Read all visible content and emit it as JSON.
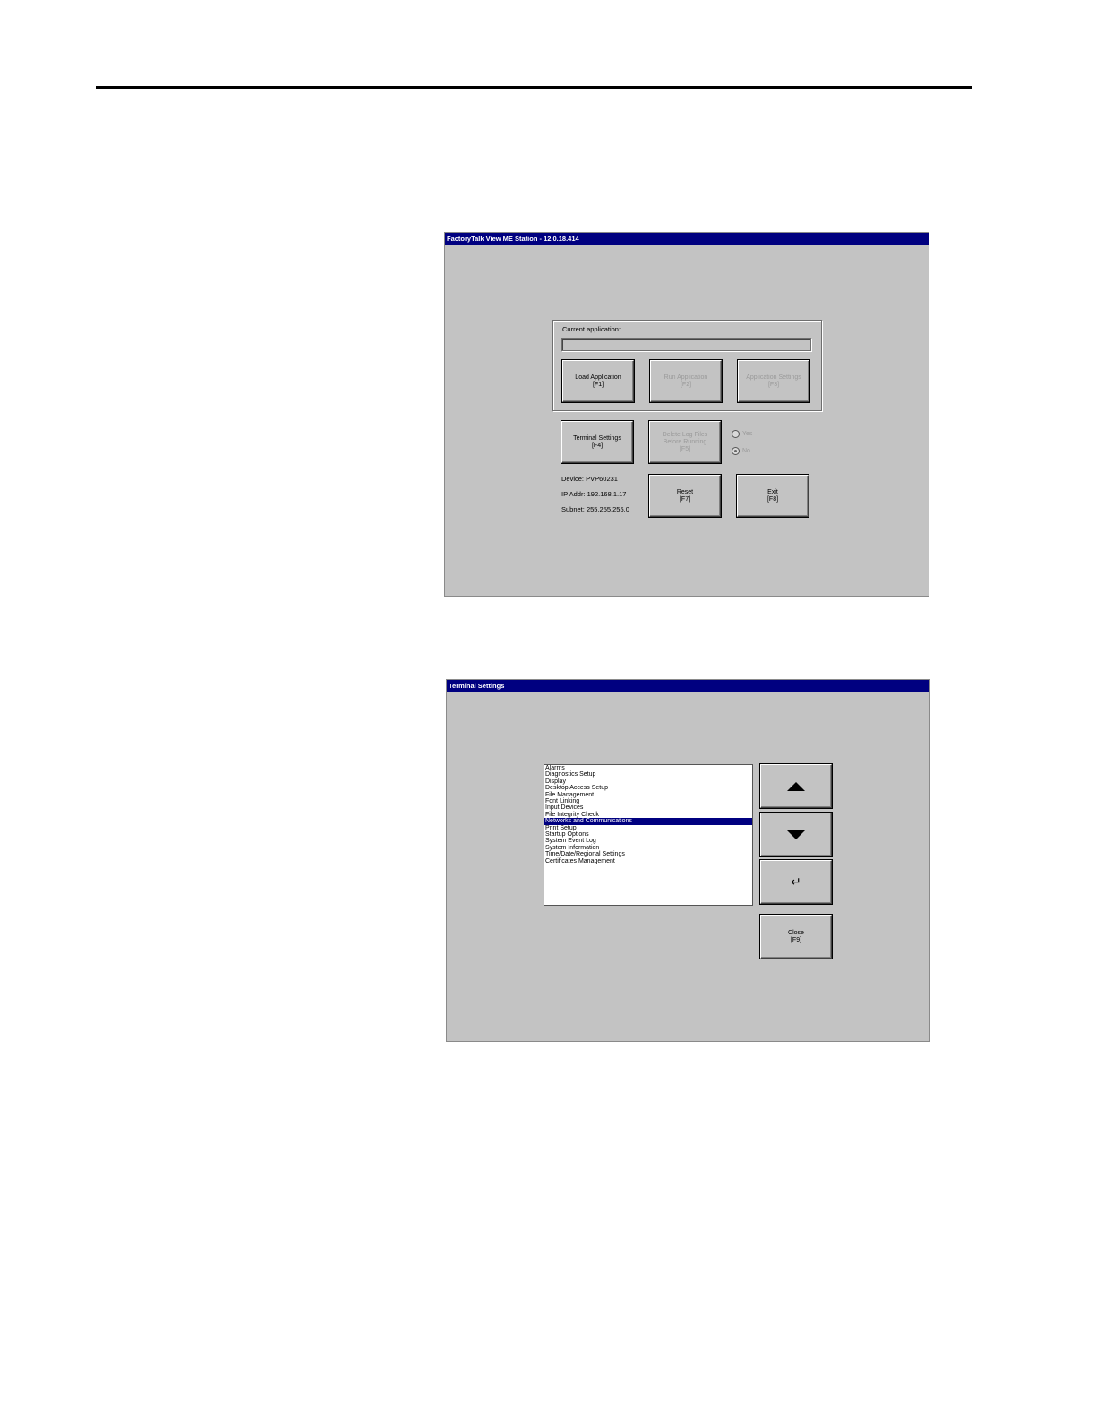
{
  "main_window": {
    "title": "FactoryTalk View ME Station - 12.0.18.414",
    "current_application_label": "Current application:",
    "current_application_value": "",
    "buttons": {
      "load_application": [
        "Load Application",
        "[F1]"
      ],
      "run_application": [
        "Run Application",
        "[F2]"
      ],
      "application_settings": [
        "Application Settings",
        "[F3]"
      ],
      "terminal_settings": [
        "Terminal Settings",
        "[F4]"
      ],
      "delete_log_files": [
        "Delete Log Files",
        "Before Running",
        "[F5]"
      ],
      "reset": [
        "Reset",
        "[F7]"
      ],
      "exit": [
        "Exit",
        "[F8]"
      ]
    },
    "radio_yes": "Yes",
    "radio_no": "No",
    "radio_selected": "No",
    "device": "Device: PVP60231",
    "ip_addr": "IP Addr: 192.168.1.17",
    "subnet": "Subnet: 255.255.255.0"
  },
  "terminal_window": {
    "title": "Terminal Settings",
    "list_items": [
      "Alarms",
      "Diagnostics Setup",
      "Display",
      "Desktop Access Setup",
      "File Management",
      "Font Linking",
      "Input Devices",
      "File Integrity Check",
      "Networks and Communications",
      "Print Setup",
      "Startup Options",
      "System Event Log",
      "System Information",
      "Time/Date/Regional Settings",
      "Certificates Management"
    ],
    "selected_item": "Networks and Communications",
    "up_icon": "up-arrow-icon",
    "down_icon": "down-arrow-icon",
    "enter_icon": "enter-icon",
    "close_button": [
      "Close",
      "[F9]"
    ]
  }
}
